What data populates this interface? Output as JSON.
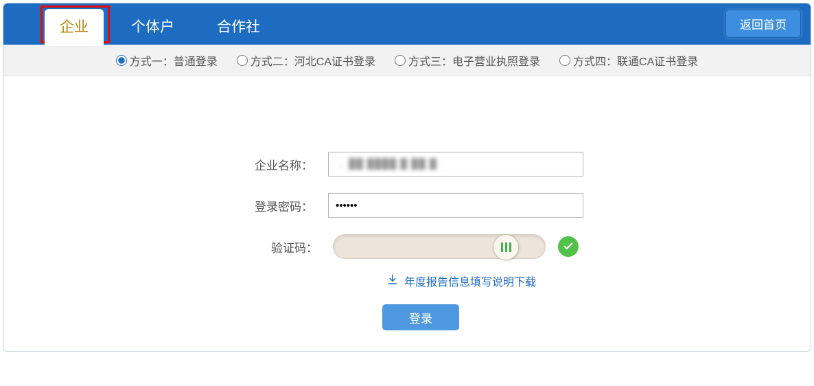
{
  "header": {
    "tabs": [
      {
        "label": "企业",
        "active": true
      },
      {
        "label": "个体户",
        "active": false
      },
      {
        "label": "合作社",
        "active": false
      }
    ],
    "return_home": "返回首页"
  },
  "methods": [
    {
      "label": "方式一：普通登录",
      "selected": true
    },
    {
      "label": "方式二：河北CA证书登录",
      "selected": false
    },
    {
      "label": "方式三：电子营业执照登录",
      "selected": false
    },
    {
      "label": "方式四：联通CA证书登录",
      "selected": false
    }
  ],
  "form": {
    "company_label": "企业名称：",
    "company_value": "",
    "password_label": "登录密码：",
    "password_value": "••••••",
    "captcha_label": "验证码：",
    "download_text": "年度报告信息填写说明下载",
    "login_button": "登录"
  }
}
